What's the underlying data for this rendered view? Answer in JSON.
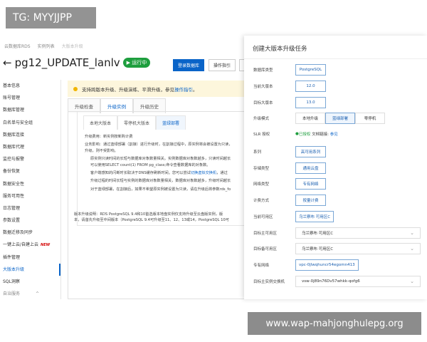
{
  "watermarks": {
    "top_left": "TG: MYYJJPP",
    "bottom_right": "www.wap-mahjonghulepg.org"
  },
  "breadcrumb": [
    "云数据库RDS",
    "实例列表",
    "大版本升级"
  ],
  "header": {
    "title": "pg12_UPDATE_lanlv",
    "status": "运行中",
    "buttons": [
      "登录数据库",
      "操作指引"
    ]
  },
  "sidebar": {
    "items": [
      "基本信息",
      "账号管理",
      "数据库管理",
      "白名单与安全组",
      "数据库连接",
      "数据库代理",
      "监控与报警",
      "备份恢复",
      "数据安全性",
      "服务可用性",
      "日志管理",
      "参数设置",
      "数据迁移及同步",
      "一键上云/自建上云",
      "插件管理",
      "大版本升级",
      "SQL洞察",
      "自治服务"
    ],
    "new_badge": "NEW",
    "active": "大版本升级"
  },
  "notice": {
    "text": "支持跨版本升级、升级演练、平滑升级，参见",
    "link": "操作指引",
    "end": "。"
  },
  "tabs": [
    "升级检查",
    "升级实例",
    "升级历史"
  ],
  "active_tab": "升级实例",
  "subtabs": [
    "本地大版本",
    "零停机大版本",
    "蓝绿部署"
  ],
  "active_subtab": "蓝绿部署",
  "content": {
    "lines": [
      "升级费用：新实例按新购计费",
      "业务影响：通过蓝绿部署（割接）进行升级时，在割接过程中，原实例将会被设置为只读，",
      "升级，则不受影响。",
      "原实例只读时间的长短与数据库对象数量相关。实例数据库对象数越多，只读时间越长",
      "可以使用SELECT count(1) FROM pg_class;命令查看数据库的对象数。",
      "客户端感知的闪断时长取决于DNS缓存刷新时间。您可以尝试",
      "升级过程的时间长短与实例的数据库对象数量相关，数据库对象数越多，升级时间越长",
      "对于蓝绿部署，在割接后，如果不希望原实例被设置为只读，请在升级后将参数rds_fo",
      "版本升级说明：RDS PostgreSQL 9.4和10首选版本地盘实例仅支持升级至云盘版实例，版",
      "本，请首先升级至中间版本（PostgreSQL 9.4可升级至11、12、13或14，PostgreSQL 10可"
    ],
    "inline_link": "切换虚拟交换机",
    "inline_after": "，通过"
  },
  "drawer": {
    "title": "创建大版本升级任务",
    "fields": {
      "db_type": {
        "label": "数据库类型",
        "value": "PostgreSQL"
      },
      "current_version": {
        "label": "当前大版本",
        "value": "12.0"
      },
      "target_version": {
        "label": "目标大版本",
        "value": "13.0"
      },
      "mode": {
        "label": "升级模式",
        "options": [
          "本地升级",
          "蓝绿部署",
          "零停机"
        ],
        "selected": "蓝绿部署"
      },
      "slr": {
        "label": "SLR 授权",
        "status": "已授权",
        "doc_label": "文档链接:",
        "doc_link": "参见"
      },
      "series": {
        "label": "系列",
        "value": "高可用系列"
      },
      "storage": {
        "label": "存储类型",
        "value": "通用云盘"
      },
      "network": {
        "label": "网络类型",
        "value": "专有网络"
      },
      "billing": {
        "label": "计费方式",
        "value": "按量计费"
      },
      "current_zone": {
        "label": "当前可用区",
        "value": "乌兰察布 可用区C"
      },
      "target_primary_zone": {
        "label": "目标主可用区",
        "value": "乌兰察布 可用区C"
      },
      "target_standby_zone": {
        "label": "目标备可用区",
        "value": "乌兰察布 可用区C"
      },
      "vpc": {
        "label": "专有网络",
        "value": "vpc-0jlwqhuncr54egomn413"
      },
      "vswitch": {
        "label": "目标主实例交换机",
        "value": "vsw-0j89n76Dv57whkk-qofg6"
      }
    }
  },
  "colors": {
    "primary": "#0a64c8",
    "running": "#1e9e3e",
    "notice_bg": "#fdf6dc"
  }
}
